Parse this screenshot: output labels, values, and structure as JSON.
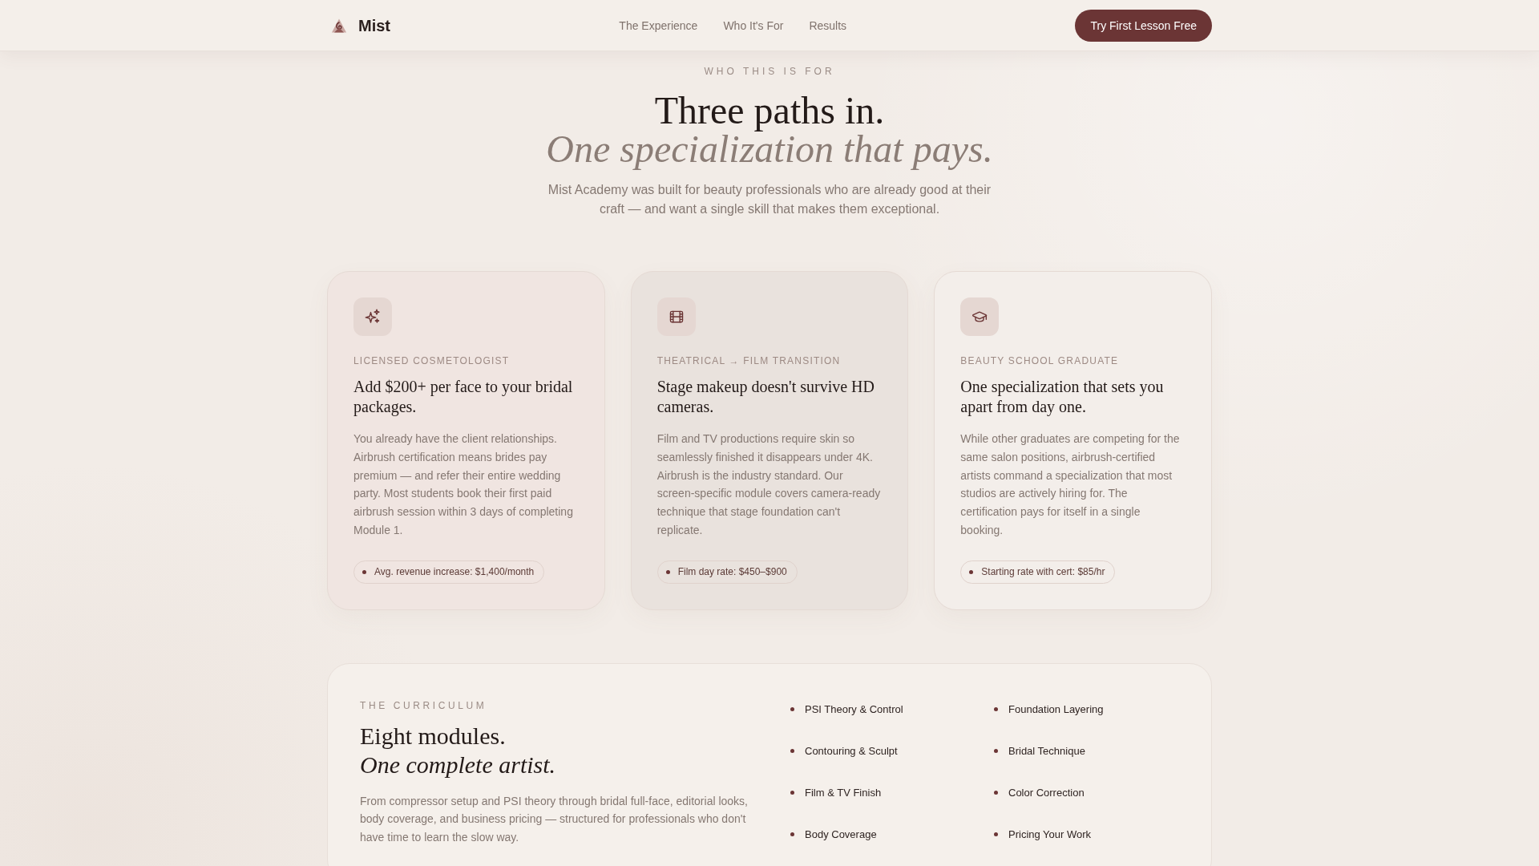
{
  "header": {
    "brand": "Mist",
    "nav": [
      "The Experience",
      "Who It's For",
      "Results"
    ],
    "cta": "Try First Lesson Free"
  },
  "intro": {
    "eyebrow": "WHO THIS IS FOR",
    "title": "Three paths in.",
    "title_accent": "One specialization that pays.",
    "lead": "Mist Academy was built for beauty professionals who are already good at their craft — and want a single skill that makes them exceptional."
  },
  "cards": [
    {
      "color": "#f0e5e1",
      "label": "LICENSED COSMETOLOGIST",
      "title": "Add $200+ per face to your bridal packages.",
      "body": "You already have the client relationships. Airbrush certification means brides pay premium — and refer their entire wedding party. Most students book their first paid airbrush session within 3 days of completing Module 1.",
      "stat": "Avg. revenue increase: $1,400/month"
    },
    {
      "color": "#e9e2dd",
      "label": "THEATRICAL → FILM TRANSITION",
      "title": "Stage makeup doesn't survive HD cameras.",
      "body": "Film and TV productions require skin so seamlessly finished it disappears under 4K. Airbrush is the industry standard. Our screen-specific module covers camera-ready technique that stage foundation can't replicate.",
      "stat": "Film day rate: $450–$900"
    },
    {
      "color": "#f3eeea",
      "label": "BEAUTY SCHOOL GRADUATE",
      "title": "One specialization that sets you apart from day one.",
      "body": "While other graduates are competing for the same salon positions, airbrush-certified artists command a specialization that most studios are actively hiring for. The certification pays for itself in a single booking.",
      "stat": "Starting rate with cert: $85/hr"
    }
  ],
  "curriculum": {
    "eyebrow": "THE CURRICULUM",
    "title": "Eight modules.",
    "title_accent": "One complete artist.",
    "text": "From compressor setup and PSI theory through bridal full-face, editorial looks, body coverage, and business pricing — structured for professionals who don't have time to learn the slow way.",
    "modules": [
      "PSI Theory & Control",
      "Foundation Layering",
      "Contouring & Sculpt",
      "Bridal Technique",
      "Film & TV Finish",
      "Color Correction",
      "Body Coverage",
      "Pricing Your Work"
    ]
  }
}
